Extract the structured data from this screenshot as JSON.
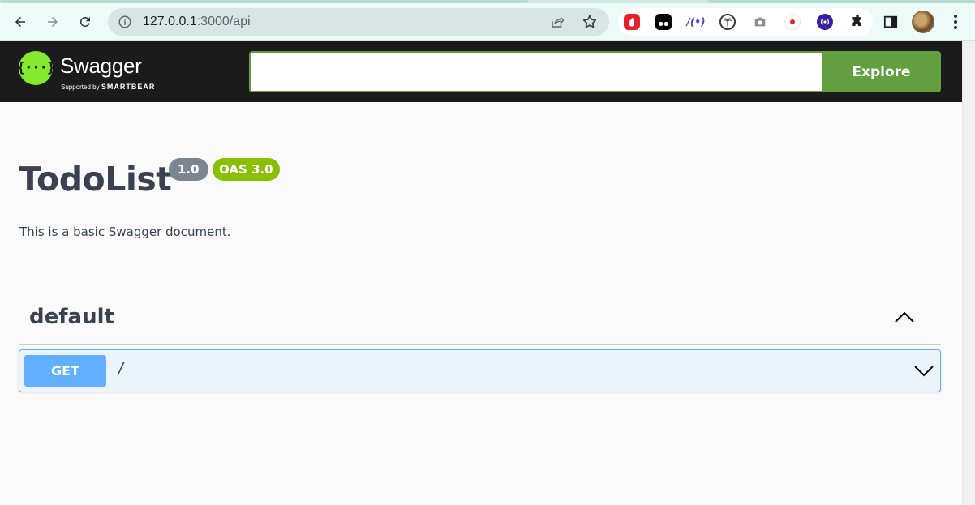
{
  "browser": {
    "url_host": "127.0.0.1",
    "url_rest": ":3000/api",
    "extensions": [
      "adblock-icon",
      "tampermonkey-icon",
      "wappalyzer-icon",
      "palm-icon",
      "camera-icon",
      "record-icon",
      "radio-icon",
      "puzzle-icon"
    ]
  },
  "header": {
    "logo_text": "Swagger",
    "logo_sub_prefix": "Supported by",
    "logo_sub_brand": "SMARTBEAR",
    "search_value": "",
    "explore_label": "Explore"
  },
  "info": {
    "title": "TodoList",
    "version": "1.0",
    "oas": "OAS 3.0",
    "description": "This is a basic Swagger document."
  },
  "tag": {
    "name": "default",
    "operations": [
      {
        "method": "GET",
        "path": "/"
      }
    ]
  },
  "colors": {
    "topbar": "#1b1b1b",
    "brand_green": "#85ea2d",
    "explore_green": "#62a03f",
    "get_blue": "#61affe",
    "oas_green": "#89bf04",
    "version_gray": "#7d8492"
  }
}
